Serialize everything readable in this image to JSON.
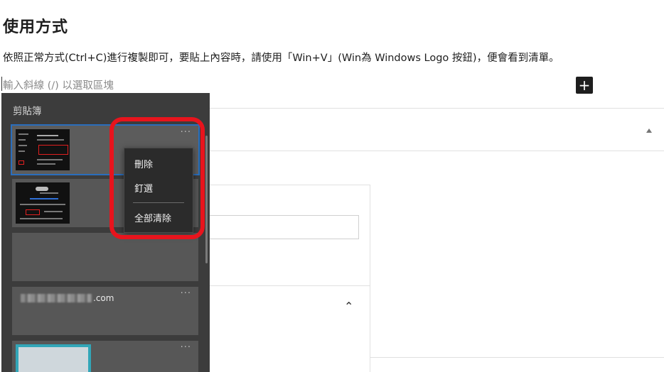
{
  "doc": {
    "heading": "使用方式",
    "paragraph": "依照正常方式(Ctrl+C)進行複製即可，要貼上內容時，請使用「Win+V」(Win為 Windows Logo 按鈕)，便會看到清單。",
    "placeholder": "輸入斜線 (/) 以選取區塊",
    "add_label": "+"
  },
  "clipboard": {
    "title": "剪貼簿",
    "more_label": "···",
    "items": [
      {
        "kind": "image"
      },
      {
        "kind": "image"
      },
      {
        "kind": "empty"
      },
      {
        "kind": "text",
        "text": ".com"
      },
      {
        "kind": "image"
      }
    ]
  },
  "context_menu": {
    "items": [
      "刪除",
      "釘選",
      "全部清除"
    ]
  },
  "colors": {
    "highlight": "#e8141d",
    "selected_outline": "#2a6ebd",
    "panel_bg": "#3c3c3c"
  }
}
